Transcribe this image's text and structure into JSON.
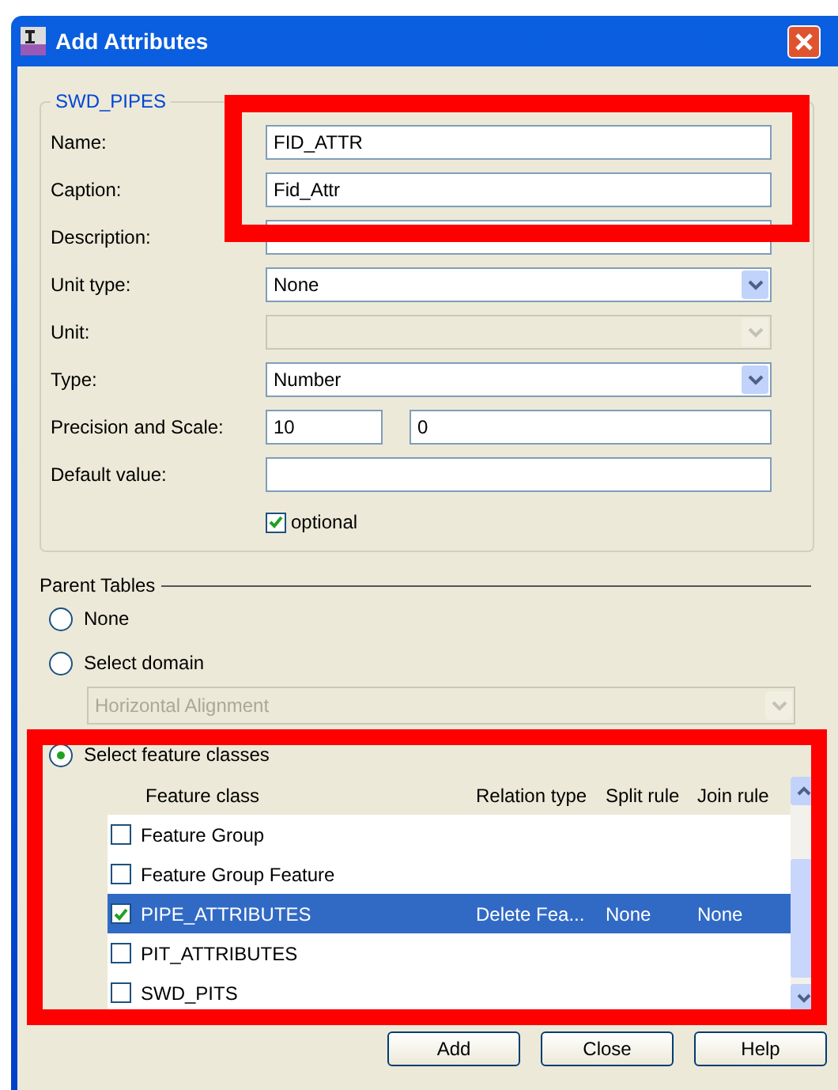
{
  "window": {
    "title": "Add Attributes"
  },
  "group": {
    "title": "SWD_PIPES",
    "fields": [
      {
        "label": "Name:",
        "kind": "text",
        "value": "FID_ATTR"
      },
      {
        "label": "Caption:",
        "kind": "text",
        "value": "Fid_Attr"
      },
      {
        "label": "Description:",
        "kind": "text"
      },
      {
        "label": "Unit type:",
        "kind": "dropdown",
        "value": "None",
        "disabled": false
      },
      {
        "label": "Unit:",
        "kind": "dropdown",
        "disabled": true
      },
      {
        "label": "Type:",
        "kind": "dropdown",
        "value": "Number",
        "disabled": false
      },
      {
        "label": "Precision and Scale:",
        "kind": "pair",
        "value": "10",
        "value2": "0"
      },
      {
        "label": "Default value:",
        "kind": "text"
      }
    ],
    "optional": {
      "label": "optional",
      "checked": true
    }
  },
  "parent_tables": {
    "title": "Parent Tables",
    "options": [
      {
        "label": "None",
        "selected": false
      },
      {
        "label": "Select domain",
        "selected": false
      }
    ],
    "domain": {
      "value": "Horizontal Alignment",
      "disabled": true
    },
    "feature_option": {
      "label": "Select feature classes",
      "selected": true
    },
    "table": {
      "columns": [
        "Feature class",
        "Relation type",
        "Split rule",
        "Join rule"
      ],
      "rows": [
        {
          "name": "Feature Group",
          "checked": false,
          "selected": false
        },
        {
          "name": "Feature Group Feature",
          "checked": false,
          "selected": false
        },
        {
          "name": "PIPE_ATTRIBUTES",
          "relation": "Delete Fea...",
          "split": "None",
          "join": "None",
          "checked": true,
          "selected": true
        },
        {
          "name": "PIT_ATTRIBUTES",
          "checked": false,
          "selected": false
        },
        {
          "name": "SWD_PITS",
          "checked": false,
          "selected": false
        }
      ]
    }
  },
  "buttons": [
    "Add",
    "Close",
    "Help"
  ]
}
